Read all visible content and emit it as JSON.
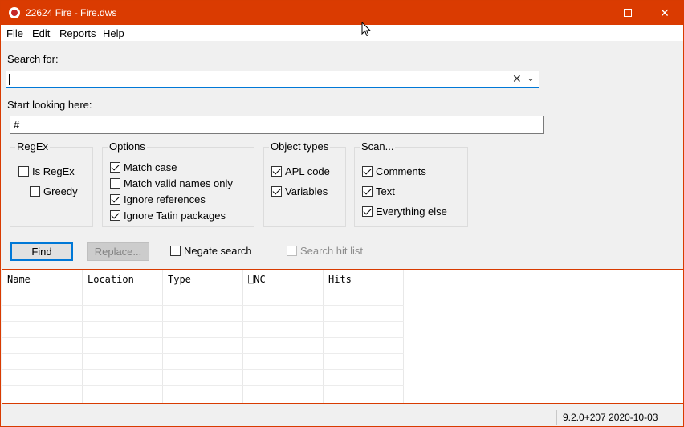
{
  "window": {
    "title": "22624 Fire - Fire.dws"
  },
  "menu": [
    "File",
    "Edit",
    "Reports",
    "Help"
  ],
  "search": {
    "label": "Search for:",
    "value": ""
  },
  "start": {
    "label": "Start looking here:",
    "value": "#"
  },
  "regex": {
    "title": "RegEx",
    "is_regex": "Is RegEx",
    "greedy": "Greedy"
  },
  "options": {
    "title": "Options",
    "match_case": "Match case",
    "valid_names": "Match valid names only",
    "ignore_refs": "Ignore references",
    "ignore_tatin": "Ignore Tatin packages"
  },
  "object_types": {
    "title": "Object types",
    "apl_code": "APL code",
    "variables": "Variables"
  },
  "scan": {
    "title": "Scan...",
    "comments": "Comments",
    "text": "Text",
    "everything_else": "Everything else"
  },
  "buttons": {
    "find": "Find",
    "replace": "Replace...",
    "negate": "Negate search",
    "search_hit_list": "Search hit list"
  },
  "grid": {
    "columns": [
      "Name",
      "Location",
      "Type",
      "⎕NC",
      "Hits"
    ]
  },
  "status": {
    "version": "9.2.0+207  2020-10-03"
  },
  "colors": {
    "titlebar": "#da3b01",
    "focus": "#0078d7"
  }
}
